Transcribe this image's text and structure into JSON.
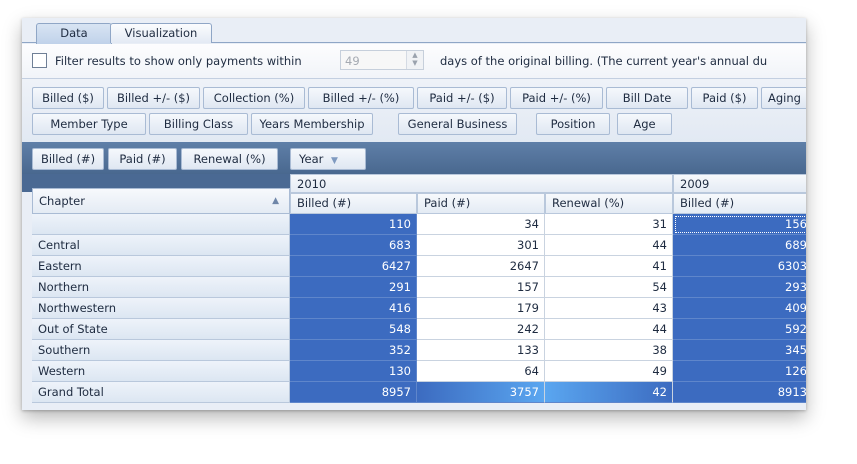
{
  "tabs": [
    {
      "label": "Data",
      "active": true
    },
    {
      "label": "Visualization",
      "active": false
    }
  ],
  "filter": {
    "checkbox_label": "Filter results to show only payments within",
    "days_value": "49",
    "suffix_text": "days of the original billing.  (The current year's annual du"
  },
  "available_fields": [
    "Billed ($)",
    "Billed +/- ($)",
    "Collection (%)",
    "Billed +/- (%)",
    "Paid +/- ($)",
    "Paid +/- (%)",
    "Bill Date",
    "Paid ($)",
    "Aging",
    "Member Type",
    "Billing Class",
    "Years Membership",
    "General Business",
    "Position",
    "Age"
  ],
  "data_fields": [
    "Billed (#)",
    "Paid (#)",
    "Renewal (%)"
  ],
  "column_field": {
    "label": "Year",
    "icon": "filter-arrow-icon"
  },
  "row_field": {
    "label": "Chapter",
    "icon": "sort-ascending-icon"
  },
  "years": [
    "2010",
    "2009"
  ],
  "measure_headers": [
    "Billed (#)",
    "Paid (#)",
    "Renewal (%)",
    "Billed (#)"
  ],
  "rows": [
    {
      "label": "",
      "values": [
        "110",
        "34",
        "31",
        "156"
      ]
    },
    {
      "label": "Central",
      "values": [
        "683",
        "301",
        "44",
        "689"
      ]
    },
    {
      "label": "Eastern",
      "values": [
        "6427",
        "2647",
        "41",
        "6303"
      ]
    },
    {
      "label": "Northern",
      "values": [
        "291",
        "157",
        "54",
        "293"
      ]
    },
    {
      "label": "Northwestern",
      "values": [
        "416",
        "179",
        "43",
        "409"
      ]
    },
    {
      "label": "Out of State",
      "values": [
        "548",
        "242",
        "44",
        "592"
      ]
    },
    {
      "label": "Southern",
      "values": [
        "352",
        "133",
        "38",
        "345"
      ]
    },
    {
      "label": "Western",
      "values": [
        "130",
        "64",
        "49",
        "126"
      ]
    },
    {
      "label": "Grand Total",
      "values": [
        "8957",
        "3757",
        "42",
        "8913"
      ]
    }
  ],
  "colors": {
    "selection": "#3c6bc0",
    "highlight": "#5aa6f0",
    "band": "#4a6993"
  }
}
